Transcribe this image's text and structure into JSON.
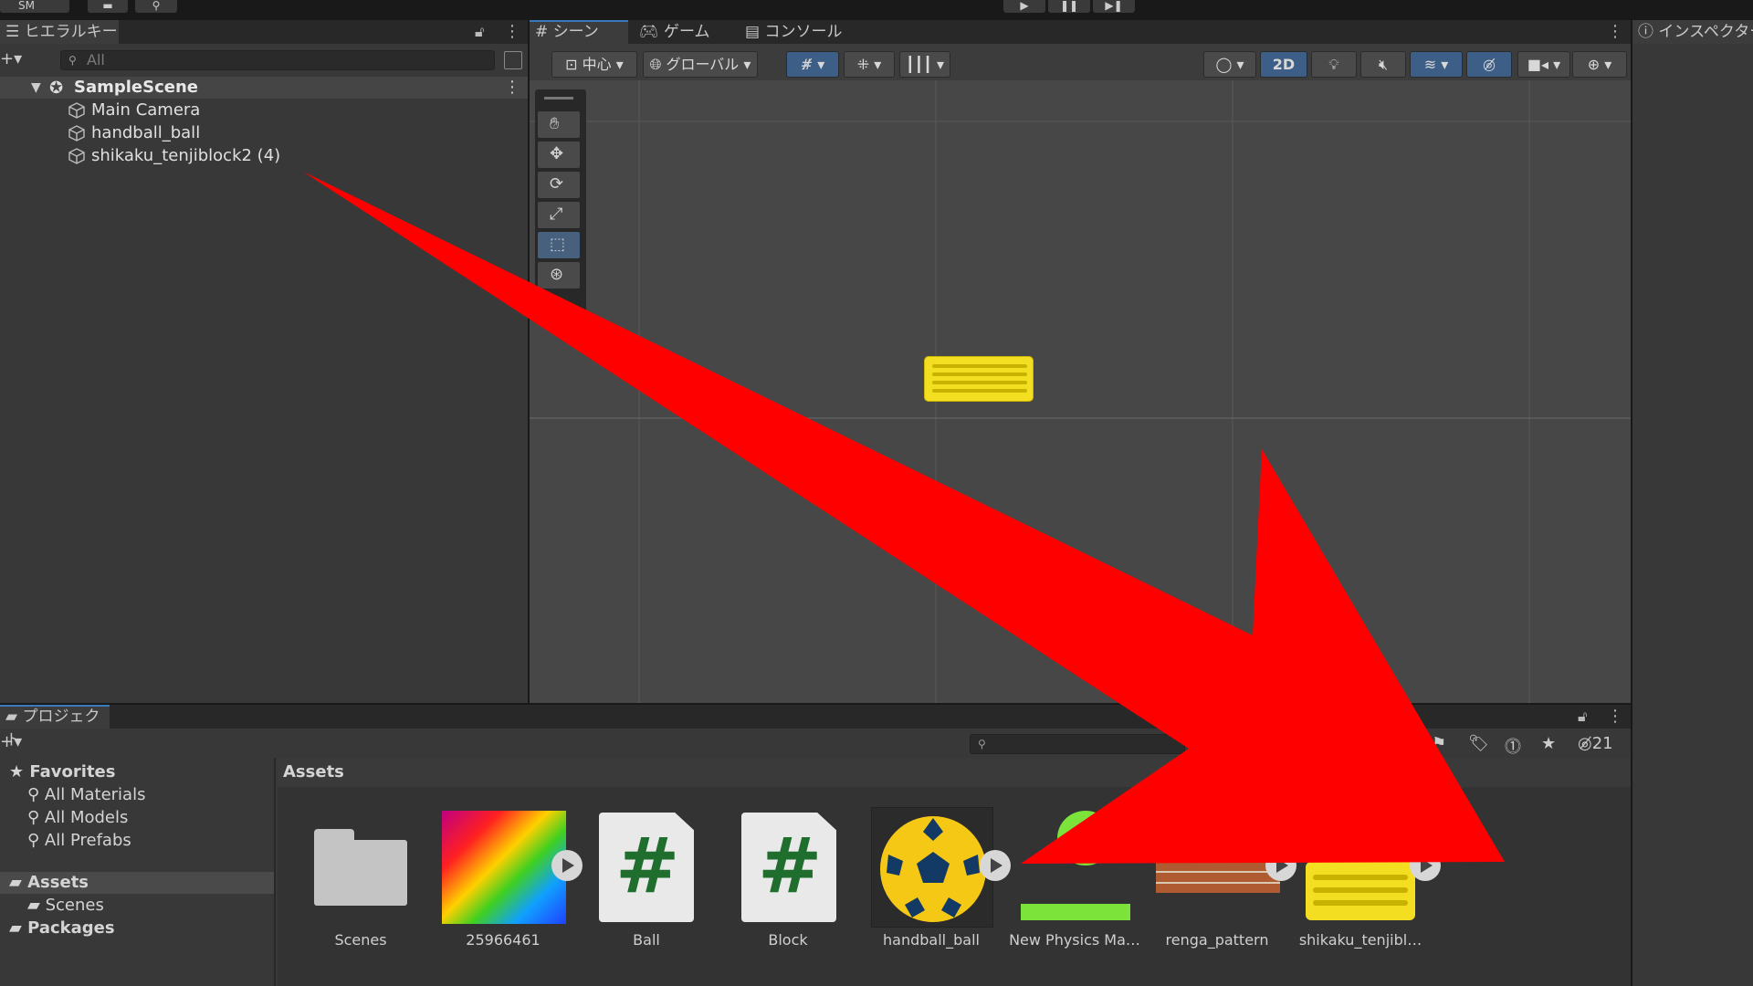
{
  "toolbar": {
    "account_label": "SM",
    "play_icon": "play-icon",
    "pause_icon": "pause-icon",
    "step_icon": "step-icon"
  },
  "hierarchy": {
    "tab_label": "ヒエラルキー",
    "search_placeholder": "All",
    "scene_name": "SampleScene",
    "items": [
      "Main Camera",
      "handball_ball",
      "shikaku_tenjiblock2 (4)"
    ]
  },
  "scene_view": {
    "tabs": [
      {
        "label": "シーン"
      },
      {
        "label": "ゲーム"
      },
      {
        "label": "コンソール"
      }
    ],
    "pivot_label": "中心",
    "space_label": "グローバル",
    "mode_2d_label": "2D"
  },
  "inspector": {
    "tab_label": "インスペクター"
  },
  "project": {
    "tab_label": "プロジェクト",
    "hidden_count": "21",
    "favorites_label": "Favorites",
    "favorites": [
      "All Materials",
      "All Models",
      "All Prefabs"
    ],
    "tree": {
      "assets": "Assets",
      "scenes": "Scenes",
      "packages": "Packages"
    },
    "breadcrumb": "Assets",
    "assets": [
      {
        "name": "Scenes",
        "kind": "folder"
      },
      {
        "name": "25966461",
        "kind": "texture"
      },
      {
        "name": "Ball",
        "kind": "script"
      },
      {
        "name": "Block",
        "kind": "script"
      },
      {
        "name": "handball_ball",
        "kind": "sprite"
      },
      {
        "name": "New Physics Ma…",
        "kind": "physics-material"
      },
      {
        "name": "renga_pattern",
        "kind": "sprite"
      },
      {
        "name": "shikaku_tenjibl…",
        "kind": "sprite"
      }
    ]
  },
  "colors": {
    "accent": "#3a79bb",
    "arrow": "#ff0000",
    "block_yellow": "#f5e024"
  }
}
